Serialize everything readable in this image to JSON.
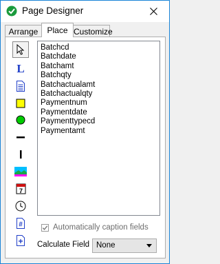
{
  "window": {
    "title": "Page Designer"
  },
  "tabs": [
    {
      "label": "Arrange"
    },
    {
      "label": "Place"
    },
    {
      "label": "Customize"
    }
  ],
  "toolbox": {
    "tools": [
      {
        "name": "pointer-icon"
      },
      {
        "name": "label-text-icon",
        "glyph": "L"
      },
      {
        "name": "memo-document-icon"
      },
      {
        "name": "rectangle-icon"
      },
      {
        "name": "ellipse-icon"
      },
      {
        "name": "horizontal-line-icon"
      },
      {
        "name": "vertical-line-icon"
      },
      {
        "name": "image-icon"
      },
      {
        "name": "calendar-date-icon",
        "glyph": "7"
      },
      {
        "name": "clock-time-icon"
      },
      {
        "name": "number-field-icon",
        "glyph": "#"
      },
      {
        "name": "calculated-field-icon",
        "glyph": "+"
      }
    ]
  },
  "fields": [
    "Batchcd",
    "Batchdate",
    "Batchamt",
    "Batchqty",
    "Batchactualamt",
    "Batchactualqty",
    "Paymentnum",
    "Paymentdate",
    "Paymenttypecd",
    "Paymentamt"
  ],
  "options": {
    "auto_caption_label": "Automatically caption fields",
    "auto_caption_checked": true,
    "calculate_field_label": "Calculate Field",
    "calculate_field_value": "None"
  },
  "colors": {
    "accent": "#1883d7",
    "title_blue": "#1f3ec8",
    "close_icon": "#000000"
  }
}
